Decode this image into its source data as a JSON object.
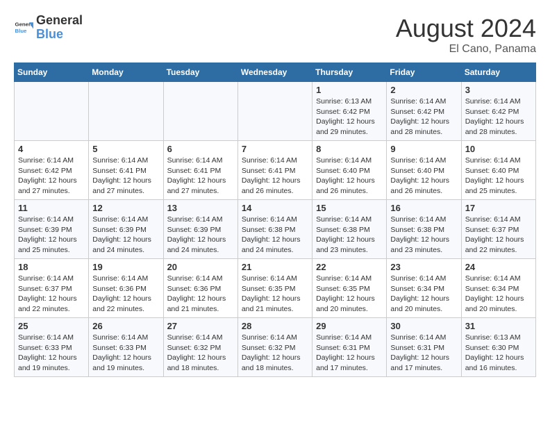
{
  "header": {
    "logo_line1": "General",
    "logo_line2": "Blue",
    "month_year": "August 2024",
    "location": "El Cano, Panama"
  },
  "weekdays": [
    "Sunday",
    "Monday",
    "Tuesday",
    "Wednesday",
    "Thursday",
    "Friday",
    "Saturday"
  ],
  "weeks": [
    [
      {
        "day": "",
        "info": ""
      },
      {
        "day": "",
        "info": ""
      },
      {
        "day": "",
        "info": ""
      },
      {
        "day": "",
        "info": ""
      },
      {
        "day": "1",
        "info": "Sunrise: 6:13 AM\nSunset: 6:42 PM\nDaylight: 12 hours\nand 29 minutes."
      },
      {
        "day": "2",
        "info": "Sunrise: 6:14 AM\nSunset: 6:42 PM\nDaylight: 12 hours\nand 28 minutes."
      },
      {
        "day": "3",
        "info": "Sunrise: 6:14 AM\nSunset: 6:42 PM\nDaylight: 12 hours\nand 28 minutes."
      }
    ],
    [
      {
        "day": "4",
        "info": "Sunrise: 6:14 AM\nSunset: 6:42 PM\nDaylight: 12 hours\nand 27 minutes."
      },
      {
        "day": "5",
        "info": "Sunrise: 6:14 AM\nSunset: 6:41 PM\nDaylight: 12 hours\nand 27 minutes."
      },
      {
        "day": "6",
        "info": "Sunrise: 6:14 AM\nSunset: 6:41 PM\nDaylight: 12 hours\nand 27 minutes."
      },
      {
        "day": "7",
        "info": "Sunrise: 6:14 AM\nSunset: 6:41 PM\nDaylight: 12 hours\nand 26 minutes."
      },
      {
        "day": "8",
        "info": "Sunrise: 6:14 AM\nSunset: 6:40 PM\nDaylight: 12 hours\nand 26 minutes."
      },
      {
        "day": "9",
        "info": "Sunrise: 6:14 AM\nSunset: 6:40 PM\nDaylight: 12 hours\nand 26 minutes."
      },
      {
        "day": "10",
        "info": "Sunrise: 6:14 AM\nSunset: 6:40 PM\nDaylight: 12 hours\nand 25 minutes."
      }
    ],
    [
      {
        "day": "11",
        "info": "Sunrise: 6:14 AM\nSunset: 6:39 PM\nDaylight: 12 hours\nand 25 minutes."
      },
      {
        "day": "12",
        "info": "Sunrise: 6:14 AM\nSunset: 6:39 PM\nDaylight: 12 hours\nand 24 minutes."
      },
      {
        "day": "13",
        "info": "Sunrise: 6:14 AM\nSunset: 6:39 PM\nDaylight: 12 hours\nand 24 minutes."
      },
      {
        "day": "14",
        "info": "Sunrise: 6:14 AM\nSunset: 6:38 PM\nDaylight: 12 hours\nand 24 minutes."
      },
      {
        "day": "15",
        "info": "Sunrise: 6:14 AM\nSunset: 6:38 PM\nDaylight: 12 hours\nand 23 minutes."
      },
      {
        "day": "16",
        "info": "Sunrise: 6:14 AM\nSunset: 6:38 PM\nDaylight: 12 hours\nand 23 minutes."
      },
      {
        "day": "17",
        "info": "Sunrise: 6:14 AM\nSunset: 6:37 PM\nDaylight: 12 hours\nand 22 minutes."
      }
    ],
    [
      {
        "day": "18",
        "info": "Sunrise: 6:14 AM\nSunset: 6:37 PM\nDaylight: 12 hours\nand 22 minutes."
      },
      {
        "day": "19",
        "info": "Sunrise: 6:14 AM\nSunset: 6:36 PM\nDaylight: 12 hours\nand 22 minutes."
      },
      {
        "day": "20",
        "info": "Sunrise: 6:14 AM\nSunset: 6:36 PM\nDaylight: 12 hours\nand 21 minutes."
      },
      {
        "day": "21",
        "info": "Sunrise: 6:14 AM\nSunset: 6:35 PM\nDaylight: 12 hours\nand 21 minutes."
      },
      {
        "day": "22",
        "info": "Sunrise: 6:14 AM\nSunset: 6:35 PM\nDaylight: 12 hours\nand 20 minutes."
      },
      {
        "day": "23",
        "info": "Sunrise: 6:14 AM\nSunset: 6:34 PM\nDaylight: 12 hours\nand 20 minutes."
      },
      {
        "day": "24",
        "info": "Sunrise: 6:14 AM\nSunset: 6:34 PM\nDaylight: 12 hours\nand 20 minutes."
      }
    ],
    [
      {
        "day": "25",
        "info": "Sunrise: 6:14 AM\nSunset: 6:33 PM\nDaylight: 12 hours\nand 19 minutes."
      },
      {
        "day": "26",
        "info": "Sunrise: 6:14 AM\nSunset: 6:33 PM\nDaylight: 12 hours\nand 19 minutes."
      },
      {
        "day": "27",
        "info": "Sunrise: 6:14 AM\nSunset: 6:32 PM\nDaylight: 12 hours\nand 18 minutes."
      },
      {
        "day": "28",
        "info": "Sunrise: 6:14 AM\nSunset: 6:32 PM\nDaylight: 12 hours\nand 18 minutes."
      },
      {
        "day": "29",
        "info": "Sunrise: 6:14 AM\nSunset: 6:31 PM\nDaylight: 12 hours\nand 17 minutes."
      },
      {
        "day": "30",
        "info": "Sunrise: 6:14 AM\nSunset: 6:31 PM\nDaylight: 12 hours\nand 17 minutes."
      },
      {
        "day": "31",
        "info": "Sunrise: 6:13 AM\nSunset: 6:30 PM\nDaylight: 12 hours\nand 16 minutes."
      }
    ]
  ]
}
